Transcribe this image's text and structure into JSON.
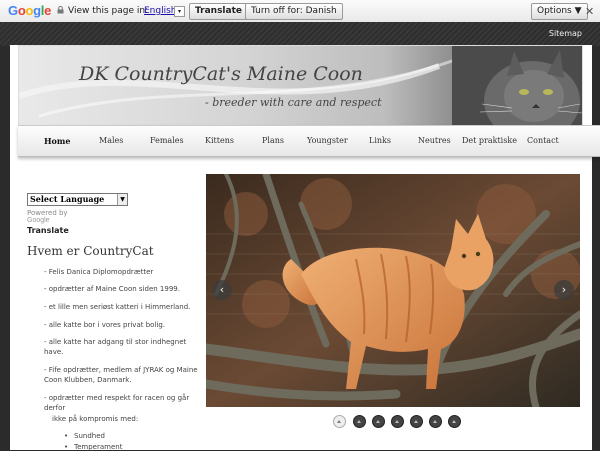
{
  "translate_bar": {
    "logo": "Google",
    "view_text": "View this page in:",
    "language": "English",
    "translate_button": "Translate",
    "turn_off_button": "Turn off for: Danish",
    "options_button": "Options ▼",
    "close": "✕"
  },
  "header": {
    "sitemap": "Sitemap",
    "title": "DK CountryCat's Maine Coon",
    "subtitle": "- breeder with care and respect"
  },
  "nav": [
    "Home",
    "Males",
    "Females",
    "Kittens",
    "Plans",
    "Youngster",
    "Links",
    "Neutres",
    "Det praktiske",
    "Contact"
  ],
  "nav_active": "Home",
  "sidebar": {
    "select_language": "Select Language",
    "powered_by": "Powered by",
    "google": "Google",
    "translate_link": "Translate",
    "heading": "Hvem er CountryCat",
    "items": [
      "- Felis Danica Diplomopdrætter",
      "- opdrætter af Maine Coon siden 1999.",
      "- et lille men seriøst katteri i Himmerland.",
      "- alle katte bor i vores privat bolig.",
      "- alle katte har adgang til stor indhegnet have.",
      "- Fife opdrætter, medlem af JYRAK og Maine Coon Klubben, Danmark.",
      "- opdrætter med respekt for racen og går derfor",
      "ikke på kompromis med:"
    ],
    "bullets": [
      "Sundhed",
      "Temperament"
    ]
  },
  "slider": {
    "prev": "‹",
    "next": "›",
    "dot_count": 7,
    "active_dot": 0
  }
}
